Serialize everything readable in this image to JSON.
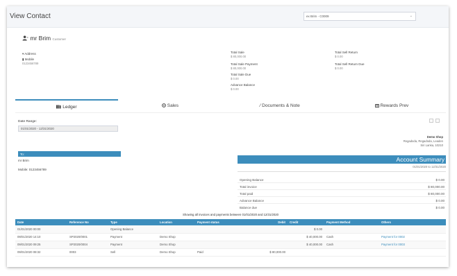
{
  "page": {
    "title": "View Contact"
  },
  "contact_select": {
    "value": "ex Brim - C0009"
  },
  "contact": {
    "name": "mr Brim",
    "tag": "Customer",
    "address_label": "Address",
    "mobile_label": "Mobile",
    "mobile_value": "0123456789"
  },
  "stats": {
    "total_sale_label": "Total Sale",
    "total_sale_value": "$ 80,000.00",
    "total_sale_payment_label": "Total Sale Payment",
    "total_sale_payment_value": "$ 80,000.00",
    "total_sale_due_label": "Total Sale Due",
    "total_sale_due_value": "$ 0.00",
    "advance_balance_label": "Advance Balance",
    "advance_balance_value": "$ 0.00",
    "total_sell_return_label": "Total Sell Return",
    "total_sell_return_value": "$ 0.00",
    "total_sell_return_due_label": "Total Sell Return Due",
    "total_sell_return_due_value": "$ 0.00"
  },
  "tabs": [
    {
      "label": "Ledger"
    },
    {
      "label": "Sales"
    },
    {
      "label": "Documents & Note"
    },
    {
      "label": "Rewards Prev"
    }
  ],
  "ledger": {
    "date_range_label": "Date Range:",
    "date_range_value": "01/01/2020 - 12/31/2020",
    "business": {
      "name": "Demo Shop",
      "line1": "Regadoda, Regadoda, Leaden",
      "line2": "Siri Lanka, 10210"
    },
    "to_label": "To:",
    "to_name": "mr Brim",
    "to_mobile": "Mobile: 0123456789",
    "account_summary_title": "Account Summary",
    "account_summary_range": "01/01/2020 to 12/31/2020",
    "summary_rows": [
      {
        "label": "Opening Balance",
        "value": "$ 0.00"
      },
      {
        "label": "Total invoice",
        "value": "$ 80,000.00"
      },
      {
        "label": "Total paid",
        "value": "$ 80,000.00"
      },
      {
        "label": "Advance Balance",
        "value": "$ 0.00"
      },
      {
        "label": "Balance due",
        "value": "$ 0.00"
      }
    ],
    "showing_text": "Showing all invoices and payments between 01/01/2020 and 12/31/2020",
    "columns": [
      "Date",
      "Reference No",
      "Type",
      "Location",
      "Payment status",
      "Debit",
      "Credit",
      "Payment Method",
      "Others"
    ],
    "rows": [
      [
        "01/01/2020 00:00",
        "",
        "Opening Balance",
        "",
        "",
        "",
        "$ 0.00",
        "",
        ""
      ],
      [
        "09/01/2020 14:10",
        "SP2020/0001",
        "Payment",
        "Demo Shop",
        "",
        "",
        "$ 40,000.00",
        "Cash",
        "Payment for 0002"
      ],
      [
        "09/01/2020 09:25",
        "SP2020/0004",
        "Payment",
        "Demo Shop",
        "",
        "",
        "$ 40,000.00",
        "Cash",
        "Payment for 0003"
      ],
      [
        "09/01/2020 08:32",
        "0003",
        "Sell",
        "Demo Shop",
        "Paid",
        "$ 80,000.00",
        "",
        "",
        ""
      ]
    ]
  },
  "colors": {
    "primary": "#3c8dbc",
    "topbar": "#f4f6f9"
  }
}
